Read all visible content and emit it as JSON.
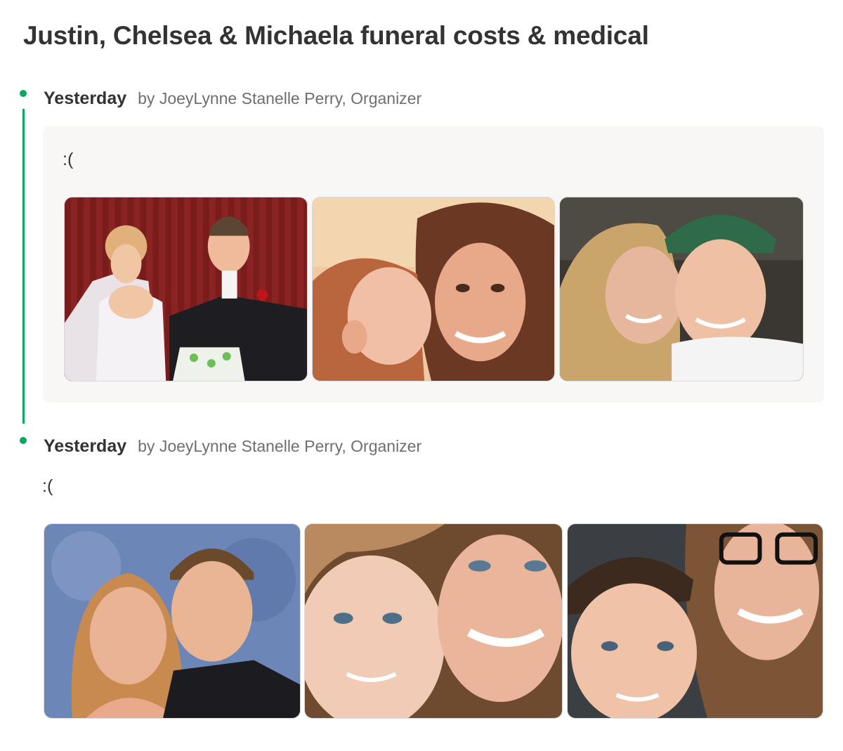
{
  "page": {
    "title": "Justin, Chelsea & Michaela funeral costs & medical"
  },
  "theme": {
    "accent_color": "#02a95c",
    "card_background": "#f9f7f5"
  },
  "updates": [
    {
      "when": "Yesterday",
      "byline": "by JoeyLynne Stanelle Perry, Organizer",
      "text": ":(",
      "photos": [
        "wedding-cake-photo",
        "kiss-on-cheek-photo",
        "couple-selfie-photo"
      ]
    },
    {
      "when": "Yesterday",
      "byline": "by JoeyLynne Stanelle Perry, Organizer",
      "text": ":(",
      "photos": [
        "couple-portrait-photo",
        "mother-daughter-selfie-photo",
        "mother-son-selfie-photo"
      ]
    }
  ]
}
